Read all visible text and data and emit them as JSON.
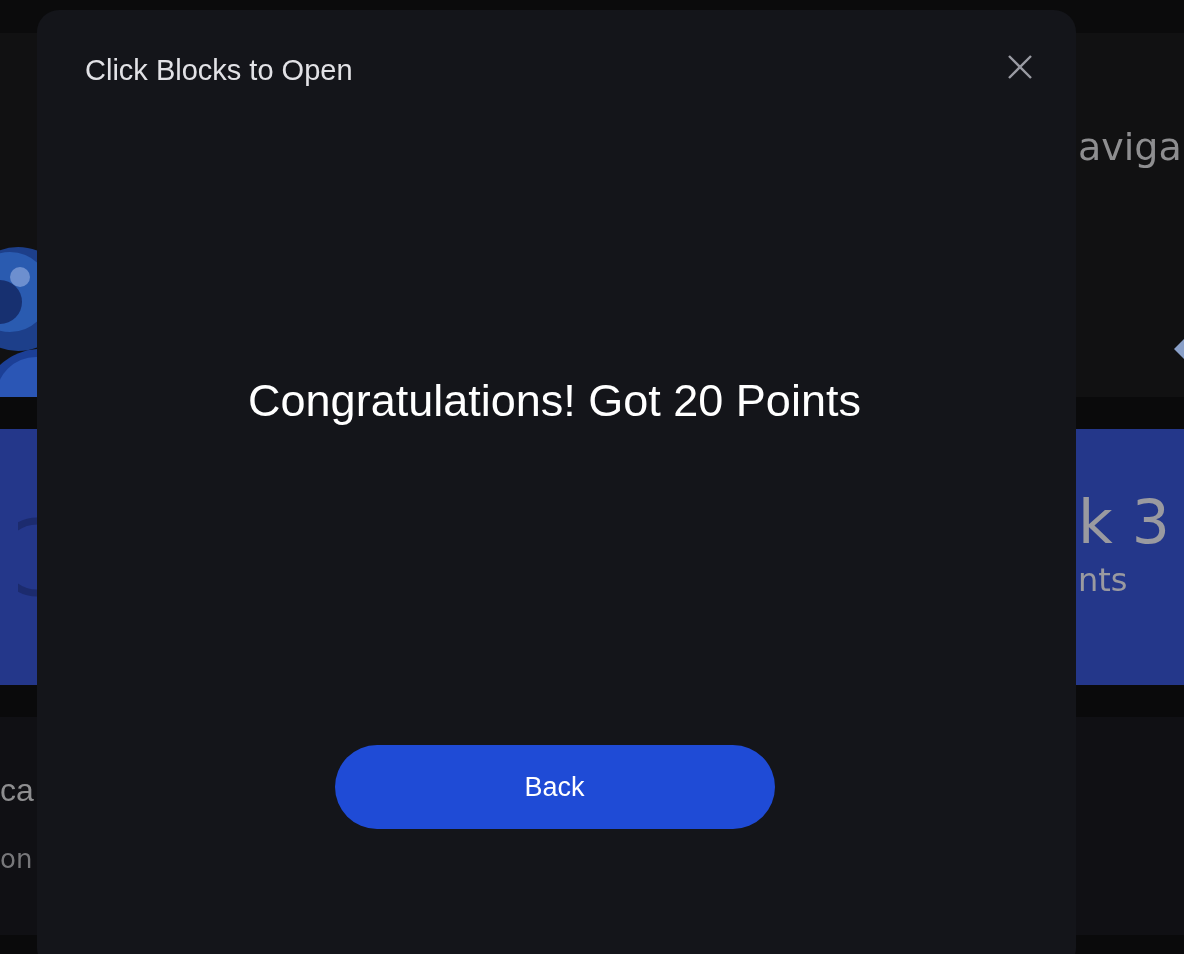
{
  "background": {
    "nav_fragment": "aviga",
    "band_title_fragment": "k 3",
    "band_subtitle_fragment": "nts",
    "card_title_fragment": "ca",
    "card_text_fragment": "on"
  },
  "dialog": {
    "title": "Click Blocks to Open",
    "message": "Congratulations! Got 20 Points",
    "button": "Back"
  }
}
